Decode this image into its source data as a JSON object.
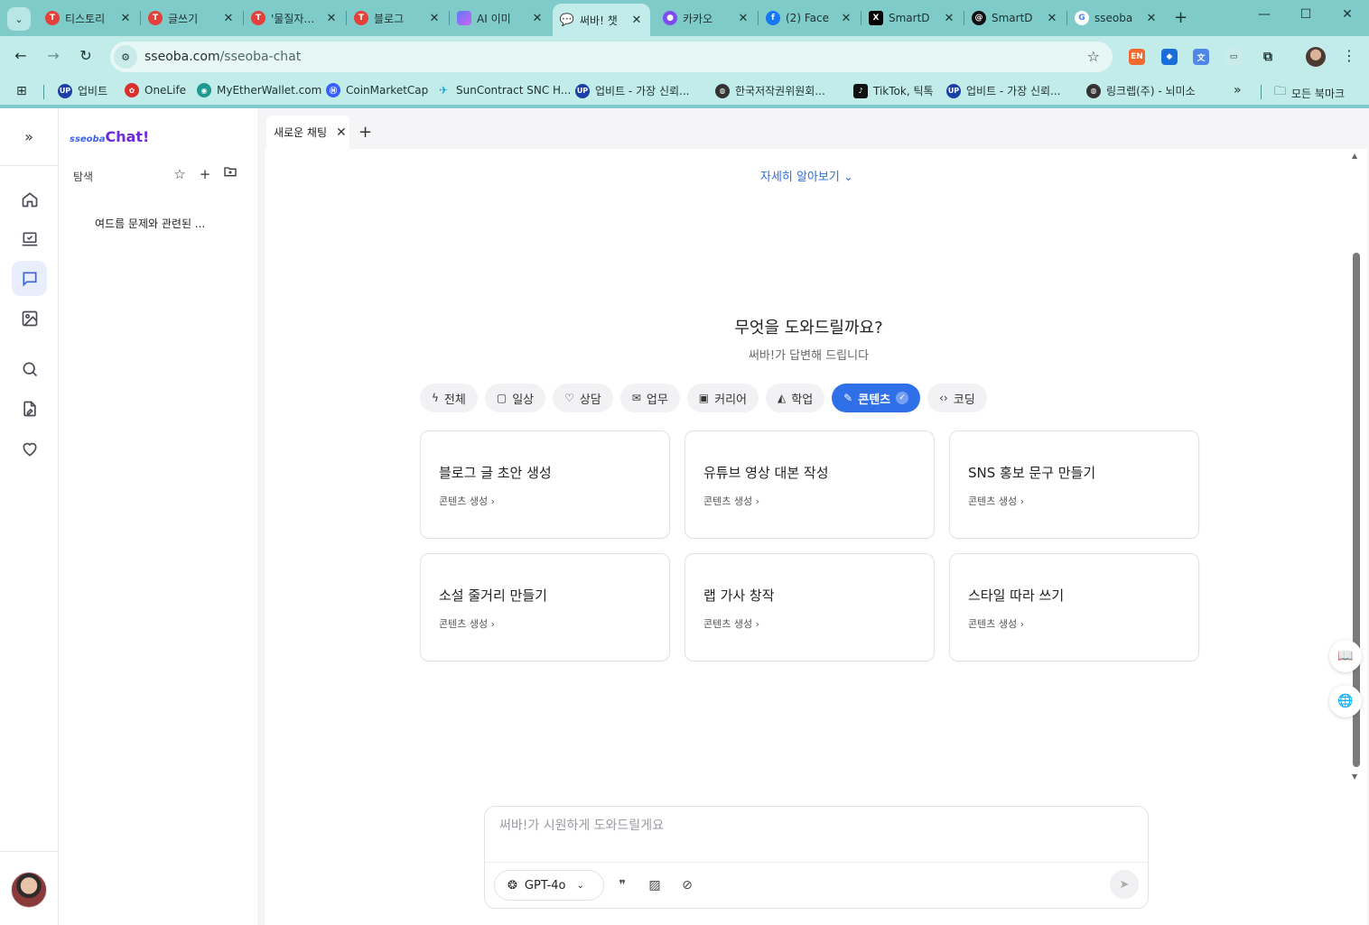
{
  "browser": {
    "tabs": [
      {
        "title": "티스토리",
        "favicon": "tistory-icon"
      },
      {
        "title": "글쓰기",
        "favicon": "tistory-icon"
      },
      {
        "title": "'물질자…",
        "favicon": "tistory-icon"
      },
      {
        "title": "블로그",
        "favicon": "tistory-icon"
      },
      {
        "title": "AI 이미",
        "favicon": "ai-image-icon"
      },
      {
        "title": "써바! 챗",
        "favicon": "sseoba-chat-icon"
      },
      {
        "title": "카카오",
        "favicon": "kakao-icon"
      },
      {
        "title": "(2) Face",
        "favicon": "facebook-icon"
      },
      {
        "title": "SmartD",
        "favicon": "x-icon"
      },
      {
        "title": "SmartD",
        "favicon": "threads-icon"
      },
      {
        "title": "sseoba",
        "favicon": "google-icon"
      }
    ],
    "active_tab_index": 5,
    "url_host": "sseoba.com",
    "url_path": "/sseoba-chat",
    "bookmarks": [
      {
        "label": "업비트"
      },
      {
        "label": "OneLife"
      },
      {
        "label": "MyEtherWallet.com"
      },
      {
        "label": "CoinMarketCap"
      },
      {
        "label": "SunContract SNC H..."
      },
      {
        "label": "업비트 - 가장 신뢰..."
      },
      {
        "label": "한국저작권위원회..."
      },
      {
        "label": "TikTok, 틱톡"
      },
      {
        "label": "업비트 - 가장 신뢰..."
      },
      {
        "label": "링크렙(주) - 뇌미소"
      }
    ],
    "all_bookmarks_label": "모든 북마크"
  },
  "sidebar": {
    "logo_prefix": "sseoba",
    "logo_main": "Chat!",
    "section_label": "탐색",
    "history": [
      {
        "title": "여드름 문제와 관련된 ..."
      }
    ]
  },
  "chat": {
    "tab_label": "새로운 채팅",
    "learn_more": "자세히 알아보기",
    "hero_title": "무엇을 도와드릴까요?",
    "hero_subtitle": "써바!가 답변해 드립니다",
    "categories": [
      {
        "label": "전체",
        "icon": "bolt-icon"
      },
      {
        "label": "일상",
        "icon": "message-icon"
      },
      {
        "label": "상담",
        "icon": "heart-icon"
      },
      {
        "label": "업무",
        "icon": "mail-icon"
      },
      {
        "label": "커리어",
        "icon": "briefcase-icon"
      },
      {
        "label": "학업",
        "icon": "graduation-cap-icon"
      },
      {
        "label": "콘텐츠",
        "icon": "pencil-icon"
      },
      {
        "label": "코딩",
        "icon": "code-icon"
      }
    ],
    "active_category": "콘텐츠",
    "cards": [
      {
        "title": "블로그 글 초안 생성",
        "subtitle": "콘텐츠 생성"
      },
      {
        "title": "유튜브 영상 대본 작성",
        "subtitle": "콘텐츠 생성"
      },
      {
        "title": "SNS 홍보 문구 만들기",
        "subtitle": "콘텐츠 생성"
      },
      {
        "title": "소설 줄거리 만들기",
        "subtitle": "콘텐츠 생성"
      },
      {
        "title": "랩 가사 창작",
        "subtitle": "콘텐츠 생성"
      },
      {
        "title": "스타일 따라 쓰기",
        "subtitle": "콘텐츠 생성"
      }
    ],
    "input_placeholder": "써바!가 시원하게 도와드릴게요",
    "model": "GPT-4o"
  },
  "colors": {
    "accent": "#2f6fe8",
    "browser_frame": "#7ecbc9",
    "logo_purple": "#6d2bd9"
  }
}
